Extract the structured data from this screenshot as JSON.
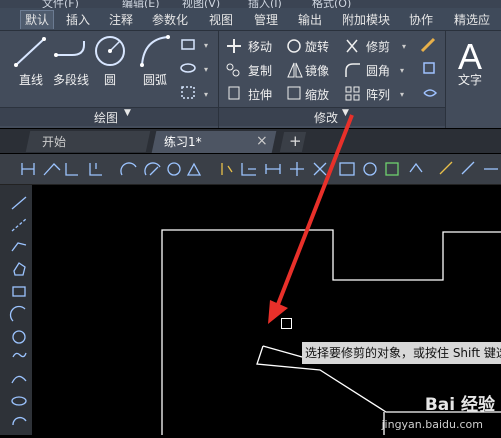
{
  "menu": {
    "items": [
      "文件(F)",
      "编辑(E)",
      "视图(V)",
      "插入(I)",
      "格式(O)"
    ]
  },
  "ribbon_tabs": [
    {
      "label": "默认",
      "active": true
    },
    {
      "label": "插入"
    },
    {
      "label": "注释"
    },
    {
      "label": "参数化"
    },
    {
      "label": "视图"
    },
    {
      "label": "管理"
    },
    {
      "label": "输出"
    },
    {
      "label": "附加模块"
    },
    {
      "label": "协作"
    },
    {
      "label": "精选应用"
    }
  ],
  "draw_panel": {
    "name": "绘图",
    "tools": {
      "line": "直线",
      "polyline": "多段线",
      "circle": "圆",
      "arc": "圆弧"
    }
  },
  "modify_panel": {
    "name": "修改",
    "tools": {
      "move": "移动",
      "rotate": "旋转",
      "trim": "修剪",
      "copy": "复制",
      "mirror": "镜像",
      "fillet": "圆角",
      "stretch": "拉伸",
      "scale": "缩放",
      "array": "阵列"
    }
  },
  "annotation_panel": {
    "text": "文字"
  },
  "doc_tabs": {
    "start": "开始",
    "current": "练习1*",
    "close_glyph": "×",
    "new_glyph": "+"
  },
  "tooltip": {
    "text": "选择要修剪的对象，或按住 Shift 键选"
  },
  "watermark": {
    "brand": "Bai 经验",
    "url": "jingyan.baidu.com"
  },
  "colors": {
    "arrow": "#e8302a",
    "canvas": "#000000",
    "ribbon": "#434c5b"
  }
}
